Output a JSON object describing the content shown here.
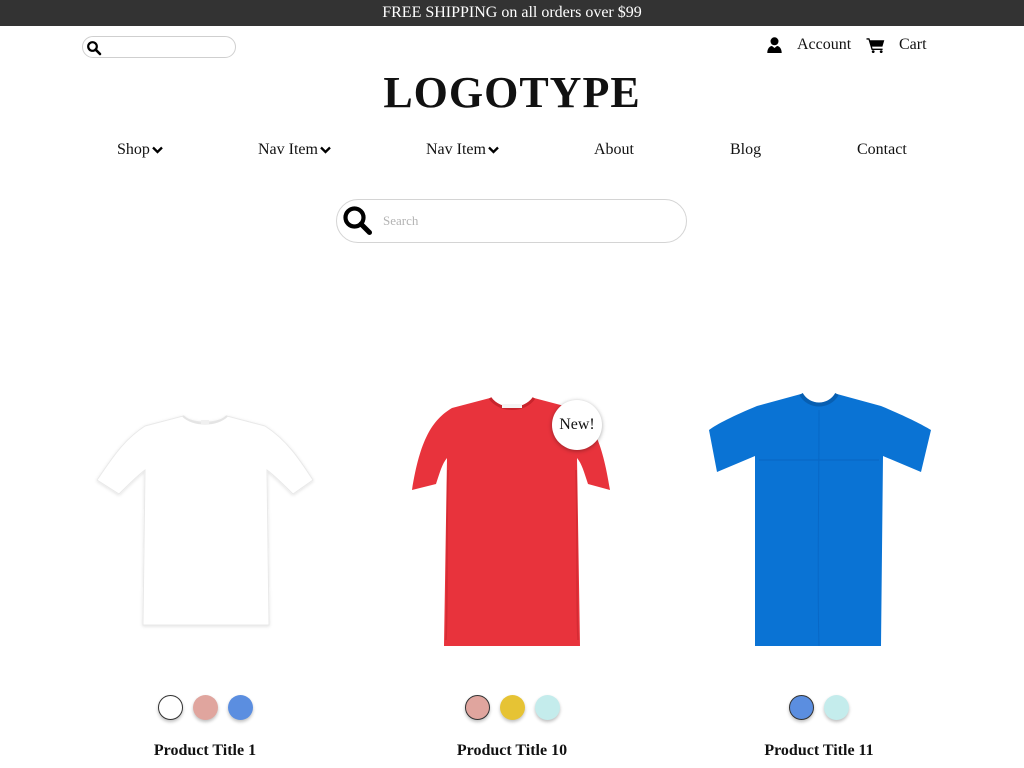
{
  "promo": {
    "text": "FREE SHIPPING on all orders over $99"
  },
  "header": {
    "search_placeholder": "",
    "account_label": "Account",
    "cart_label": "Cart",
    "logo": "LOGOTYPE"
  },
  "nav": {
    "items": [
      {
        "label": "Shop",
        "has_dropdown": true
      },
      {
        "label": "Nav Item",
        "has_dropdown": true
      },
      {
        "label": "Nav Item",
        "has_dropdown": true
      },
      {
        "label": "About",
        "has_dropdown": false
      },
      {
        "label": "Blog",
        "has_dropdown": false
      },
      {
        "label": "Contact",
        "has_dropdown": false
      }
    ]
  },
  "search": {
    "placeholder": "Search"
  },
  "products": [
    {
      "title": "Product Title 1",
      "image_icon": "white-tshirt",
      "shirt_color": "#ffffff",
      "badge": "",
      "swatches": [
        "#ffffff",
        "#e0a59e",
        "#5b8ee0"
      ],
      "selected_swatch": 0
    },
    {
      "title": "Product Title 10",
      "image_icon": "red-tshirt",
      "shirt_color": "#e8333c",
      "badge": "New!",
      "swatches": [
        "#e0a59e",
        "#e6c334",
        "#c4ecec"
      ],
      "selected_swatch": 0
    },
    {
      "title": "Product Title 11",
      "image_icon": "blue-tshirt",
      "shirt_color": "#0a73d4",
      "badge": "",
      "swatches": [
        "#5b8ee0",
        "#c4ecec"
      ],
      "selected_swatch": 0
    }
  ],
  "colors": {
    "promo_bar": "#333333",
    "text": "#111111"
  }
}
